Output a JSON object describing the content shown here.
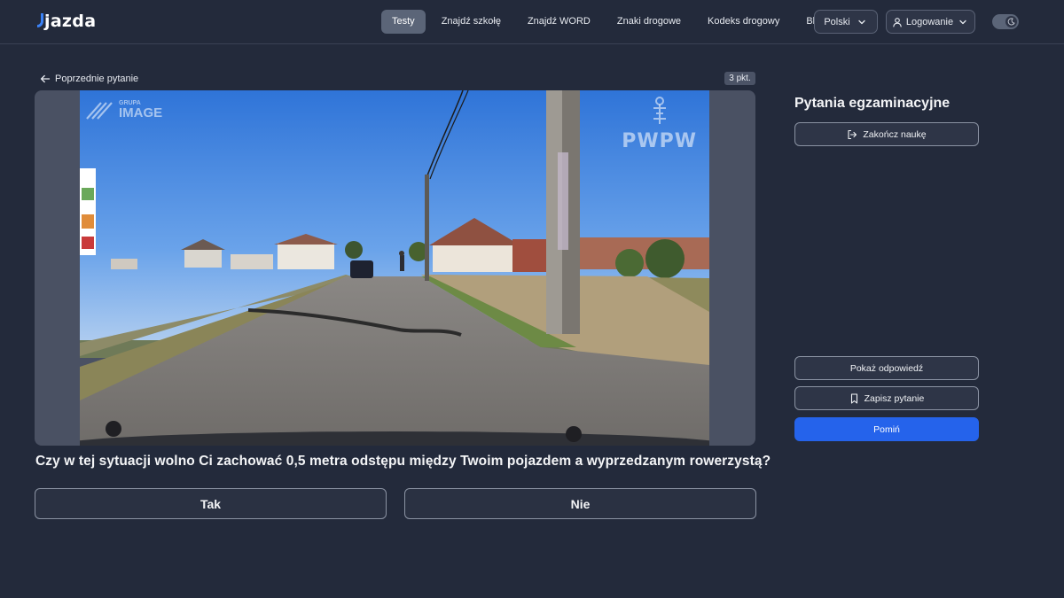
{
  "header": {
    "logo_text": "jazda",
    "nav": [
      {
        "label": "Testy",
        "active": true
      },
      {
        "label": "Znajdź szkołę",
        "active": false
      },
      {
        "label": "Znajdź WORD",
        "active": false
      },
      {
        "label": "Znaki drogowe",
        "active": false
      },
      {
        "label": "Kodeks drogowy",
        "active": false
      },
      {
        "label": "Blog",
        "active": false
      }
    ],
    "language_label": "Polski",
    "login_label": "Logowanie",
    "theme_toggle_icon": "moon-icon"
  },
  "question": {
    "prev_label": "Poprzednie pytanie",
    "points": "3 pkt.",
    "watermark_left": "IMAGE",
    "watermark_left_small": "GRUPA",
    "watermark_right": "PWPW",
    "text": "Czy w tej sytuacji wolno Ci zachować 0,5 metra odstępu między Twoim pojazdem a wyprzedzanym rowerzystą?",
    "answers": [
      "Tak",
      "Nie"
    ]
  },
  "sidebar": {
    "title": "Pytania egzaminacyjne",
    "finish_label": "Zakończ naukę",
    "show_answer_label": "Pokaż odpowiedź",
    "save_label": "Zapisz pytanie",
    "skip_label": "Pomiń"
  },
  "colors": {
    "background": "#232a3b",
    "accent": "#2563eb",
    "active_nav": "#5b6578"
  }
}
